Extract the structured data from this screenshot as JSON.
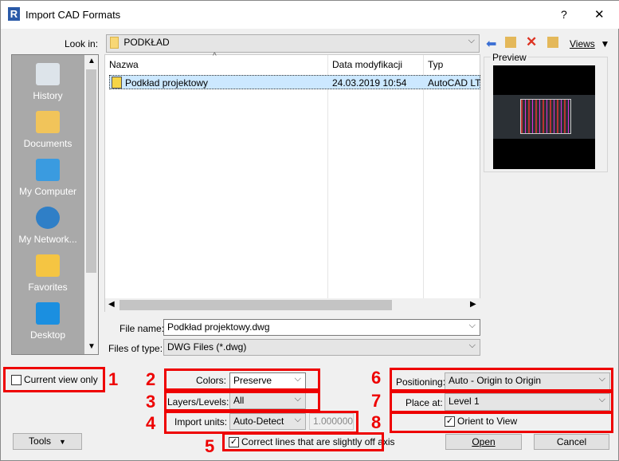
{
  "window": {
    "title": "Import CAD Formats",
    "help": "?",
    "close": "✕"
  },
  "lookin": {
    "label": "Look in:",
    "value": "PODKŁAD"
  },
  "toolbar": {
    "views": "Views"
  },
  "sidebar": {
    "items": [
      {
        "label": "History"
      },
      {
        "label": "Documents"
      },
      {
        "label": "My Computer"
      },
      {
        "label": "My Network..."
      },
      {
        "label": "Favorites"
      },
      {
        "label": "Desktop"
      }
    ]
  },
  "filelist": {
    "columns": [
      "Nazwa",
      "Data modyfikacji",
      "Typ"
    ],
    "rows": [
      {
        "name": "Podkład projektowy",
        "date": "24.03.2019 10:54",
        "type": "AutoCAD LT"
      }
    ]
  },
  "preview": {
    "label": "Preview"
  },
  "filename": {
    "label": "File name:",
    "value": "Podkład projektowy.dwg"
  },
  "filetype": {
    "label": "Files of type:",
    "value": "DWG Files  (*.dwg)"
  },
  "options": {
    "current_view": {
      "label": "Current view only",
      "checked": false
    },
    "colors": {
      "label": "Colors:",
      "value": "Preserve"
    },
    "layers": {
      "label": "Layers/Levels:",
      "value": "All"
    },
    "units": {
      "label": "Import units:",
      "value": "Auto-Detect",
      "factor": "1.000000"
    },
    "correct_lines": {
      "label": "Correct lines that are slightly off axis",
      "checked": true
    },
    "positioning": {
      "label": "Positioning:",
      "value": "Auto - Origin to Origin"
    },
    "place_at": {
      "label": "Place at:",
      "value": "Level 1"
    },
    "orient": {
      "label": "Orient to View",
      "checked": true
    }
  },
  "annotations": [
    "1",
    "2",
    "3",
    "4",
    "5",
    "6",
    "7",
    "8"
  ],
  "buttons": {
    "tools": "Tools",
    "open": "Open",
    "cancel": "Cancel"
  },
  "colors": {
    "highlight": "#e00000",
    "selection": "#cce8ff"
  }
}
